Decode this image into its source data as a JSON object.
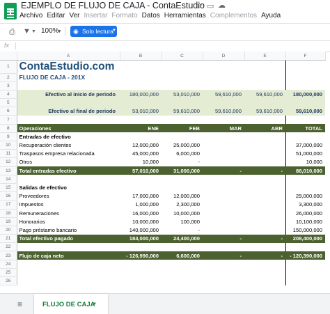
{
  "app": {
    "doc_title": "EJEMPLO DE FLUJO DE CAJA - ContaEstudio",
    "menu": [
      {
        "label": "Archivo",
        "enabled": true
      },
      {
        "label": "Editar",
        "enabled": true
      },
      {
        "label": "Ver",
        "enabled": true
      },
      {
        "label": "Insertar",
        "enabled": false
      },
      {
        "label": "Formato",
        "enabled": false
      },
      {
        "label": "Datos",
        "enabled": true
      },
      {
        "label": "Herramientas",
        "enabled": true
      },
      {
        "label": "Complementos",
        "enabled": false
      },
      {
        "label": "Ayuda",
        "enabled": true
      }
    ]
  },
  "toolbar": {
    "zoom": "100%",
    "readonly_label": "Solo lectura"
  },
  "formula_bar": {
    "fx": "fx"
  },
  "columns": [
    "A",
    "B",
    "C",
    "D",
    "E",
    "F"
  ],
  "rows": [
    {
      "n": "1",
      "kind": "brand",
      "a": "ContaEstudio.com"
    },
    {
      "n": "2",
      "kind": "subtitle",
      "a": "FLUJO DE CAJA - 201X"
    },
    {
      "n": "3",
      "kind": "blank"
    },
    {
      "n": "4",
      "kind": "green",
      "a": "Efectivo al inicio de periodo",
      "v": [
        "180,000,000",
        "53,010,000",
        "59,610,000",
        "59,610,000",
        "180,000,000"
      ]
    },
    {
      "n": "5",
      "kind": "green-blank"
    },
    {
      "n": "6",
      "kind": "green",
      "a": "Efectivo al final de periodo",
      "v": [
        "53,010,000",
        "59,610,000",
        "59,610,000",
        "59,610,000",
        "59,610,000"
      ]
    },
    {
      "n": "7",
      "kind": "blank"
    },
    {
      "n": "8",
      "kind": "dark",
      "a": "Operaciones",
      "v": [
        "ENE",
        "FEB",
        "MAR",
        "ABR",
        "TOTAL"
      ]
    },
    {
      "n": "9",
      "kind": "section",
      "a": "Entradas de efectivo"
    },
    {
      "n": "10",
      "kind": "data",
      "a": "Recuperación clientes",
      "v": [
        "12,000,000",
        "25,000,000",
        "",
        "",
        "37,000,000"
      ]
    },
    {
      "n": "11",
      "kind": "data",
      "a": "Traspasos empresa relacionada",
      "v": [
        "45,000,000",
        "6,000,000",
        "",
        "",
        "51,000,000"
      ]
    },
    {
      "n": "12",
      "kind": "data",
      "a": "Otros",
      "v": [
        "10,000",
        "-",
        "",
        "",
        "10,000"
      ]
    },
    {
      "n": "13",
      "kind": "dark-total",
      "a": "Total entradas efectivo",
      "v": [
        "57,010,000",
        "31,000,000",
        "-",
        "-",
        "88,010,000"
      ]
    },
    {
      "n": "14",
      "kind": "blank"
    },
    {
      "n": "15",
      "kind": "section",
      "a": "Salidas de efectivo"
    },
    {
      "n": "16",
      "kind": "data",
      "a": "Proveedores",
      "v": [
        "17,000,000",
        "12,000,000",
        "",
        "",
        "29,000,000"
      ]
    },
    {
      "n": "17",
      "kind": "data",
      "a": "Impuestos",
      "v": [
        "1,000,000",
        "2,300,000",
        "",
        "",
        "3,300,000"
      ]
    },
    {
      "n": "18",
      "kind": "data",
      "a": "Remuneraciones",
      "v": [
        "16,000,000",
        "10,000,000",
        "",
        "",
        "26,000,000"
      ]
    },
    {
      "n": "19",
      "kind": "data",
      "a": "Honorarios",
      "v": [
        "10,000,000",
        "100,000",
        "",
        "",
        "10,100,000"
      ]
    },
    {
      "n": "20",
      "kind": "data",
      "a": "Pago préstamo bancario",
      "v": [
        "140,000,000",
        "-",
        "",
        "",
        "150,000,000"
      ]
    },
    {
      "n": "21",
      "kind": "dark-total",
      "a": "Total efectivo pagado",
      "v": [
        "184,000,000",
        "24,400,000",
        "-",
        "-",
        "208,400,000"
      ]
    },
    {
      "n": "22",
      "kind": "blank"
    },
    {
      "n": "23",
      "kind": "dark-total",
      "a": "Flujo de caja neto",
      "v": [
        "- 126,990,000",
        "6,600,000",
        "-",
        "-",
        "- 120,390,000"
      ]
    },
    {
      "n": "24",
      "kind": "blank"
    },
    {
      "n": "25",
      "kind": "blank"
    },
    {
      "n": "26",
      "kind": "blank"
    }
  ],
  "sheet_tab": {
    "label": "FLUJO DE CAJA"
  }
}
